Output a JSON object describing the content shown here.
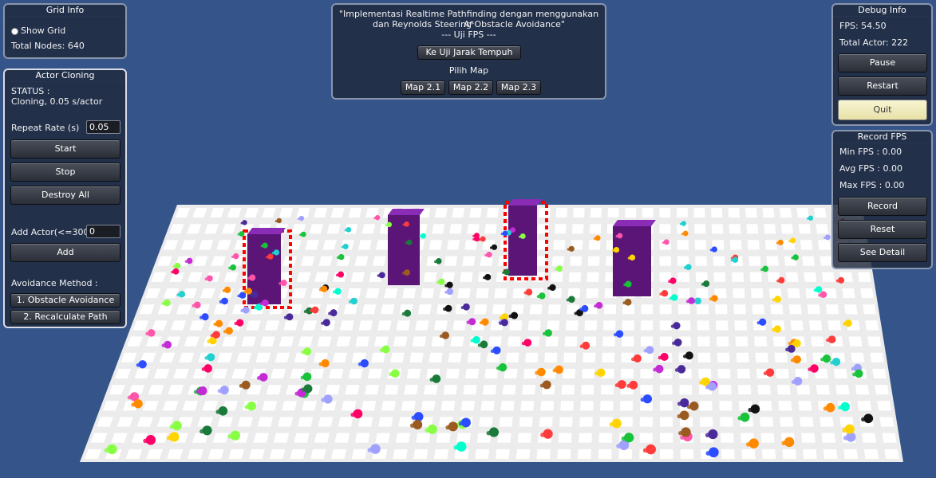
{
  "grid_info": {
    "title": "Grid Info",
    "show_grid_label": "Show Grid",
    "total_nodes": "Total Nodes: 640"
  },
  "actor_cloning": {
    "title": "Actor Cloning",
    "status_label": "STATUS :",
    "status_value": "Cloning, 0.05 s/actor",
    "repeat_rate_label": "Repeat Rate (s)",
    "repeat_rate_value": "0.05",
    "start_label": "Start",
    "stop_label": "Stop",
    "destroy_all_label": "Destroy All",
    "add_actor_label": "Add Actor(<=300)",
    "add_actor_value": "0",
    "add_label": "Add",
    "avoidance_label": "Avoidance Method :",
    "method1_label": "1. Obstacle Avoidance",
    "method2_label": "2. Recalculate Path"
  },
  "header": {
    "line1": "\"Implementasi Realtime Pathfinding dengan menggunakan A*",
    "line2": "dan Reynolds Steering Obstacle Avoidance\"",
    "line3": "--- Uji FPS ---",
    "jarak_button": "Ke Uji Jarak Tempuh",
    "pilih_map": "Pilih Map",
    "map1": "Map 2.1",
    "map2": "Map 2.2",
    "map3": "Map 2.3"
  },
  "debug_info": {
    "title": "Debug Info",
    "fps": "FPS: 54.50",
    "total_actor": "Total Actor: 222",
    "pause_label": "Pause",
    "restart_label": "Restart",
    "quit_label": "Quit"
  },
  "record_fps": {
    "title": "Record FPS",
    "min_fps": "Min FPS : 0.00",
    "avg_fps": "Avg FPS : 0.00",
    "max_fps": "Max FPS : 0.00",
    "record_label": "Record",
    "reset_label": "Reset",
    "see_detail_label": "See Detail"
  },
  "colors": {
    "background": "#35558a",
    "plane": "#ffffff",
    "obstacle": "#5a1577",
    "hazard": "#ff0000"
  }
}
